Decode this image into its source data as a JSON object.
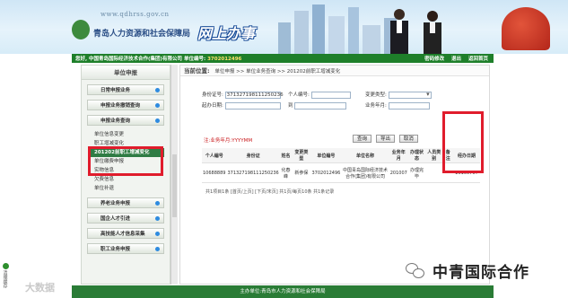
{
  "header": {
    "url": "www.qdhrss.gov.cn",
    "org_name": "青岛人力资源和社会保障局",
    "online_office": "网上办事"
  },
  "navbar": {
    "greeting_prefix": "您好,",
    "company": "中国青岛国际经济技术合作(集团)有限公司",
    "unit_code_label": "单位编号:",
    "unit_code": "3702012496",
    "links": [
      "密码修改",
      "退出",
      "返回首页"
    ]
  },
  "sidebar": {
    "title": "单位申报",
    "sections_top": [
      "日常申报业务",
      "申报业务撤销查询",
      "申报业务查询"
    ],
    "sub_items": [
      "单位信息变更",
      "职工增减变化",
      "201202前职工增减变化",
      "单位缴费申报"
    ],
    "active_sub_index": 2,
    "sub_items_2": [
      "实物信息",
      "欠费信息",
      "单位补退"
    ],
    "sections_bottom": [
      "养老业务申报",
      "国企人才引进",
      "高技能人才信息采集",
      "职工业务申报"
    ]
  },
  "breadcrumb": {
    "position_label": "当前位置:",
    "path": "单位申报 >> 单位业务查询 >> 201202前职工增减变化"
  },
  "form": {
    "id_label": "身份证号:",
    "id_value": "371327198111250236",
    "person_no_label": "个人编号:",
    "change_type_label": "变更类型:",
    "start_date_label": "起办日期:",
    "to_label": "到",
    "business_year_label": "业务年月:",
    "note": "注:业务年月:YYYYMM",
    "buttons": [
      "查询",
      "导出",
      "取消"
    ]
  },
  "table": {
    "headers": [
      "个人编号",
      "身份证",
      "姓名",
      "变更类型",
      "单位编号",
      "单位名称",
      "业务年月",
      "办理状态",
      "人员类别",
      "备注",
      "经办日期"
    ],
    "rows": [
      [
        "10688889",
        "371327198111250236",
        "化春峰",
        "新参保",
        "3702012496",
        "中国青岛国际经济技术合作(集团)有限公司",
        "201007",
        "办理完毕",
        "",
        "",
        "20100707"
      ]
    ],
    "pager": "共1项目1条 [首页/上页] [下页/末页] 共1页/每页10条 共1条记录"
  },
  "footer": {
    "text": "主办单位:青岛市人力资源和社会保障局"
  },
  "watermarks": {
    "left_tab": "清理缓存",
    "left": "大数据",
    "right": "中青国际合作"
  }
}
